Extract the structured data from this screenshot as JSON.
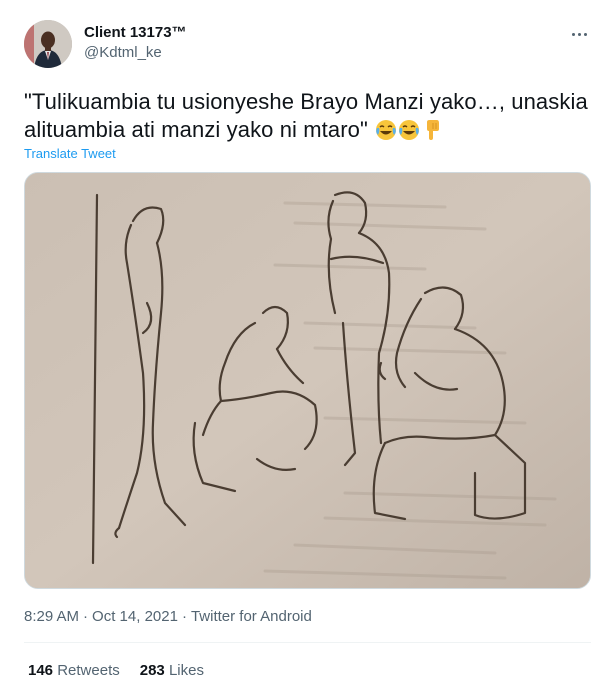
{
  "author": {
    "name": "Client 13173™",
    "handle": "@Kdtml_ke"
  },
  "tweet": {
    "text": "\"Tulikuambia tu usionyeshe Brayo Manzi yako…, unaskia alituambia ati manzi yako ni mtaro\"",
    "emojis": [
      "face-with-tears-of-joy",
      "face-with-tears-of-joy",
      "backhand-index-pointing-down"
    ],
    "translate_label": "Translate Tweet",
    "media_description_icon": "sketch-image"
  },
  "meta": {
    "time": "8:29 AM",
    "date": "Oct 14, 2021",
    "source": "Twitter for Android",
    "separator": "·"
  },
  "stats": {
    "retweets_count": "146",
    "retweets_label": "Retweets",
    "likes_count": "283",
    "likes_label": "Likes"
  },
  "colors": {
    "link": "#1d9bf0",
    "secondary_text": "#536471",
    "primary_text": "#0f1419",
    "border": "#cfd9de"
  }
}
